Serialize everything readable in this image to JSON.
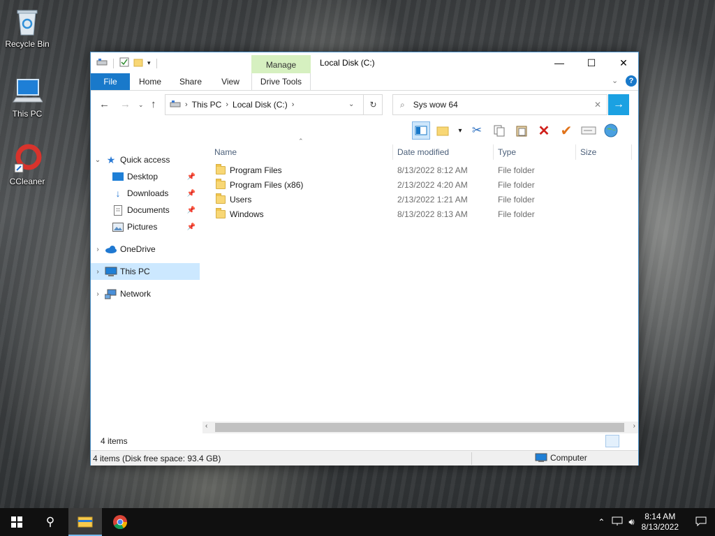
{
  "desktop": {
    "icons": [
      {
        "label": "Recycle Bin",
        "icon": "recycle-bin-icon"
      },
      {
        "label": "This PC",
        "icon": "computer-icon"
      },
      {
        "label": "CCleaner",
        "icon": "ccleaner-icon"
      }
    ]
  },
  "window": {
    "title": "Local Disk (C:)",
    "context_tab": "Manage",
    "controls": {
      "minimize": "—",
      "maximize": "☐",
      "close": "✕"
    }
  },
  "ribbon": {
    "tabs": [
      "File",
      "Home",
      "Share",
      "View",
      "Drive Tools"
    ],
    "accent": "#1979ca",
    "manage_color": "#d6f0c0"
  },
  "address": {
    "crumbs": [
      "This PC",
      "Local Disk (C:)"
    ],
    "search_value": "Sys wow 64"
  },
  "nav": {
    "items": [
      {
        "label": "Quick access",
        "icon": "star-icon",
        "expanded": true
      },
      {
        "label": "Desktop",
        "icon": "desktop-icon",
        "pinned": true
      },
      {
        "label": "Downloads",
        "icon": "downloads-icon",
        "pinned": true
      },
      {
        "label": "Documents",
        "icon": "documents-icon",
        "pinned": true
      },
      {
        "label": "Pictures",
        "icon": "pictures-icon",
        "pinned": true
      },
      {
        "label": "OneDrive",
        "icon": "cloud-icon"
      },
      {
        "label": "This PC",
        "icon": "computer-icon",
        "selected": true
      },
      {
        "label": "Network",
        "icon": "network-icon"
      }
    ]
  },
  "files": {
    "columns": [
      "Name",
      "Date modified",
      "Type",
      "Size"
    ],
    "rows": [
      {
        "name": "Program Files",
        "date": "8/13/2022 8:12 AM",
        "type": "File folder",
        "size": ""
      },
      {
        "name": "Program Files (x86)",
        "date": "2/13/2022 4:20 AM",
        "type": "File folder",
        "size": ""
      },
      {
        "name": "Users",
        "date": "2/13/2022 1:21 AM",
        "type": "File folder",
        "size": ""
      },
      {
        "name": "Windows",
        "date": "8/13/2022 8:13 AM",
        "type": "File folder",
        "size": ""
      }
    ]
  },
  "status": {
    "item_count": "4 items",
    "left": "4 items (Disk free space: 93.4 GB)",
    "right": "Computer"
  },
  "taskbar": {
    "time": "8:14 AM",
    "date": "8/13/2022"
  }
}
